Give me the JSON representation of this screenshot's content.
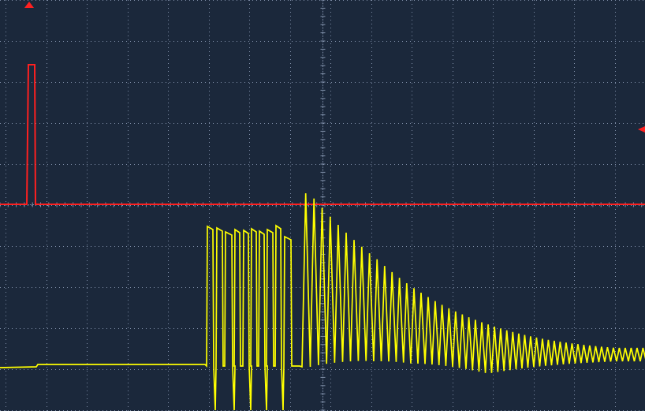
{
  "display": {
    "background": "#1b283b",
    "grid_color": "#7f8ea8",
    "divisions": {
      "horizontal": 16,
      "vertical": 10
    }
  },
  "channels": [
    {
      "id": "ch1",
      "color": "#ff2020",
      "marker": "red-trigger-marker"
    },
    {
      "id": "ch2",
      "color": "#ffff00",
      "marker": "none"
    }
  ],
  "markers": [
    {
      "name": "trigger-position-marker",
      "color": "#ff2020",
      "shape": "up-triangle"
    },
    {
      "name": "trigger-level-marker",
      "color": "#ff2020",
      "shape": "left-triangle"
    }
  ]
}
